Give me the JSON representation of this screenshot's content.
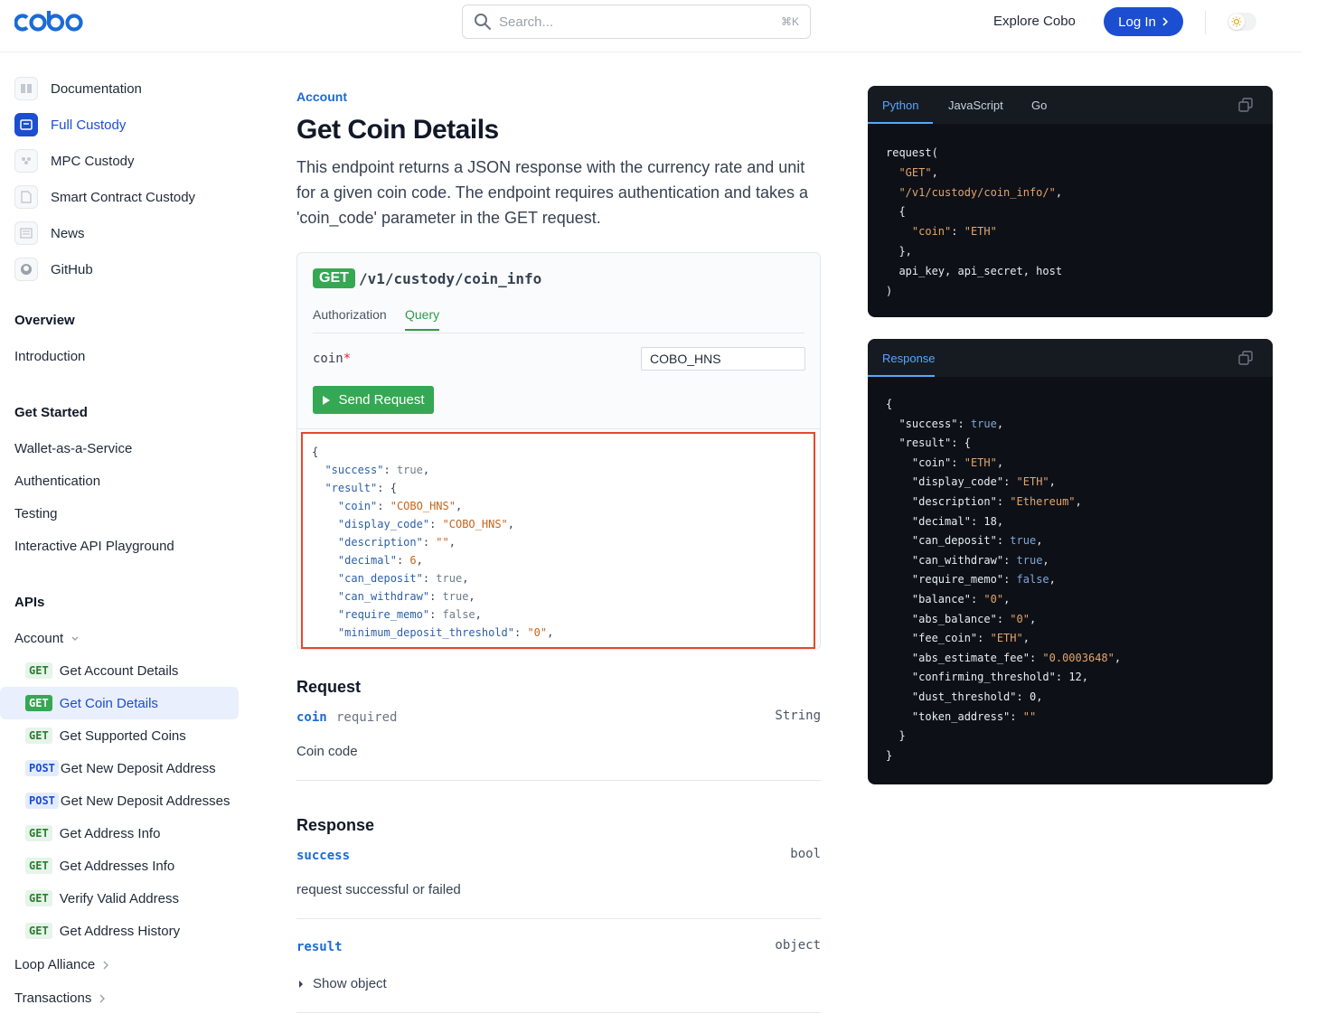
{
  "header": {
    "logo_text": "cobo",
    "search_placeholder": "Search...",
    "search_shortcut": "⌘K",
    "explore_label": "Explore Cobo",
    "login_label": "Log In"
  },
  "sidebar": {
    "top_items": [
      {
        "label": "Documentation",
        "icon": "book-icon"
      },
      {
        "label": "Full Custody",
        "icon": "vault-icon",
        "active": true
      },
      {
        "label": "MPC Custody",
        "icon": "people-icon"
      },
      {
        "label": "Smart Contract Custody",
        "icon": "document-icon"
      },
      {
        "label": "News",
        "icon": "newspaper-icon"
      },
      {
        "label": "GitHub",
        "icon": "github-icon"
      }
    ],
    "overview_heading": "Overview",
    "overview_items": [
      "Introduction"
    ],
    "get_started_heading": "Get Started",
    "get_started_items": [
      "Wallet-as-a-Service",
      "Authentication",
      "Testing",
      "Interactive API Playground"
    ],
    "apis_heading": "APIs",
    "account_group": "Account",
    "api_items": [
      {
        "method": "GET",
        "label": "Get Account Details"
      },
      {
        "method": "GET",
        "label": "Get Coin Details",
        "active": true
      },
      {
        "method": "GET",
        "label": "Get Supported Coins"
      },
      {
        "method": "POST",
        "label": "Get New Deposit Address"
      },
      {
        "method": "POST",
        "label": "Get New Deposit Addresses"
      },
      {
        "method": "GET",
        "label": "Get Address Info"
      },
      {
        "method": "GET",
        "label": "Get Addresses Info"
      },
      {
        "method": "GET",
        "label": "Verify Valid Address"
      },
      {
        "method": "GET",
        "label": "Get Address History"
      }
    ],
    "loop_alliance": "Loop Alliance",
    "transactions": "Transactions"
  },
  "main": {
    "breadcrumb": "Account",
    "title": "Get Coin Details",
    "description": "This endpoint returns a JSON response with the currency rate and unit for a given coin code. The endpoint requires authentication and takes a 'coin_code' parameter in the GET request.",
    "tryit": {
      "method": "GET",
      "path": "/v1/custody/coin_info",
      "tabs": [
        "Authorization",
        "Query"
      ],
      "active_tab": "Query",
      "field_label": "coin",
      "field_required_mark": "*",
      "field_value": "COBO_HNS",
      "send_label": "Send Request"
    },
    "try_result": {
      "open_brace": "{",
      "success_key": "\"success\"",
      "success_val": "true",
      "result_key": "\"result\"",
      "rows": [
        {
          "k": "\"coin\"",
          "v": "\"COBO_HNS\"",
          "t": "s"
        },
        {
          "k": "\"display_code\"",
          "v": "\"COBO_HNS\"",
          "t": "s"
        },
        {
          "k": "\"description\"",
          "v": "\"\"",
          "t": "s"
        },
        {
          "k": "\"decimal\"",
          "v": "6",
          "t": "n"
        },
        {
          "k": "\"can_deposit\"",
          "v": "true",
          "t": "b"
        },
        {
          "k": "\"can_withdraw\"",
          "v": "true",
          "t": "b"
        },
        {
          "k": "\"require_memo\"",
          "v": "false",
          "t": "b"
        },
        {
          "k": "\"minimum_deposit_threshold\"",
          "v": "\"0\"",
          "t": "s"
        }
      ]
    },
    "request_heading": "Request",
    "request_field": {
      "name": "coin",
      "required": "required",
      "type": "String",
      "desc": "Coin code"
    },
    "response_heading": "Response",
    "response_fields": [
      {
        "name": "success",
        "type": "bool",
        "desc": "request successful or failed"
      },
      {
        "name": "result",
        "type": "object",
        "desc": "Show object"
      }
    ]
  },
  "code_panel": {
    "tabs": [
      "Python",
      "JavaScript",
      "Go"
    ],
    "active_tab": "Python",
    "lines": [
      "request(",
      "\"GET\"",
      "\"/v1/custody/coin_info/\"",
      "{",
      "\"coin\"",
      "\"ETH\"",
      "},",
      "api_key, api_secret, host",
      ")"
    ]
  },
  "response_panel": {
    "tab": "Response",
    "rows": [
      {
        "k": "\"coin\"",
        "v": "\"ETH\"",
        "t": "s"
      },
      {
        "k": "\"display_code\"",
        "v": "\"ETH\"",
        "t": "s"
      },
      {
        "k": "\"description\"",
        "v": "\"Ethereum\"",
        "t": "s"
      },
      {
        "k": "\"decimal\"",
        "v": "18",
        "t": "n"
      },
      {
        "k": "\"can_deposit\"",
        "v": "true",
        "t": "b"
      },
      {
        "k": "\"can_withdraw\"",
        "v": "true",
        "t": "b"
      },
      {
        "k": "\"require_memo\"",
        "v": "false",
        "t": "b"
      },
      {
        "k": "\"balance\"",
        "v": "\"0\"",
        "t": "s"
      },
      {
        "k": "\"abs_balance\"",
        "v": "\"0\"",
        "t": "s"
      },
      {
        "k": "\"fee_coin\"",
        "v": "\"ETH\"",
        "t": "s"
      },
      {
        "k": "\"abs_estimate_fee\"",
        "v": "\"0.0003648\"",
        "t": "s"
      },
      {
        "k": "\"confirming_threshold\"",
        "v": "12",
        "t": "n"
      },
      {
        "k": "\"dust_threshold\"",
        "v": "0",
        "t": "n"
      },
      {
        "k": "\"token_address\"",
        "v": "\"\"",
        "t": "s",
        "last": true
      }
    ]
  },
  "colors": {
    "brand": "#1b4ed0",
    "get_green": "#34a853",
    "highlight_border": "#e8472b"
  }
}
